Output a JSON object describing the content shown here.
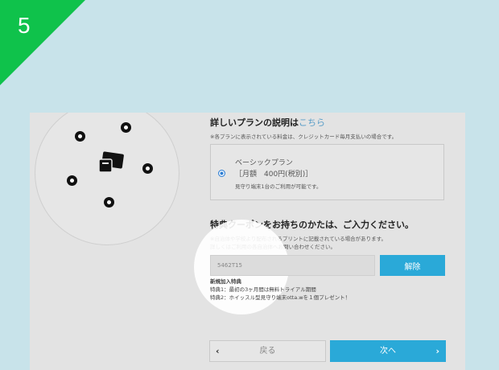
{
  "step": {
    "number": "5"
  },
  "plan_section": {
    "title": "詳しいプランの説明は",
    "link": "こちら",
    "note": "※各プランに表示されている料金は、クレジットカード毎月支払いの場合です。",
    "plan": {
      "name": "ベーシックプラン",
      "price": "［月額　400円(税別)］",
      "sub": "見守り端末1台のご利用が可能です。",
      "selected": true
    }
  },
  "coupon_section": {
    "title": "特典クーポンをお持ちのかたは、ご入力ください。",
    "note1": "※自治体や学校より配布されるプリントに記載されている場合があります。",
    "note2": "詳しくはご利用の各自治体へお問い合わせください。",
    "input_value": "5462T15",
    "cancel_label": "解除",
    "benefits_title": "新規加入特典",
    "benefit1": "特典1：最初の3ヶ月間は無料トライアル期間",
    "benefit2": "特典2：ホイッスル型見守り端末otta.wを１個プレゼント！"
  },
  "nav": {
    "back_label": "戻る",
    "next_label": "次へ"
  },
  "colors": {
    "accent": "#2aa9d8",
    "step_badge": "#0fc24b",
    "background": "#c8e3ea"
  },
  "icons": [
    "devices-icon",
    "radio-selected-icon",
    "chevron-left-icon",
    "chevron-right-icon"
  ]
}
